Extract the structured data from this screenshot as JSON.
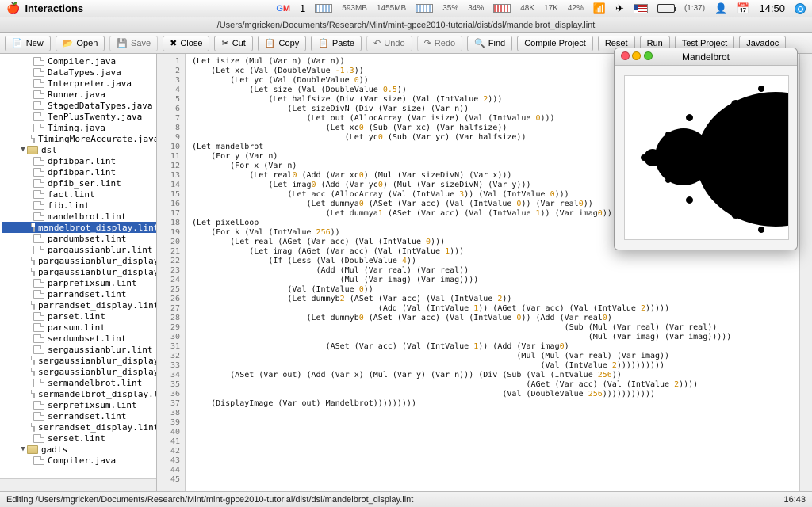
{
  "menubar": {
    "app_name": "Interactions",
    "gmail_count": "1",
    "mem_top": "593MB",
    "mem_bot": "1455MB",
    "pct1": "35%",
    "pct2": "34%",
    "net1": "48K",
    "net2": "17K",
    "pct3": "42%",
    "battery_time": "(1:37)",
    "clock": "14:50"
  },
  "pathbar": {
    "path": "/Users/mgricken/Documents/Research/Mint/mint-gpce2010-tutorial/dist/dsl/mandelbrot_display.lint"
  },
  "toolbar": {
    "new": "New",
    "open": "Open",
    "save": "Save",
    "close": "Close",
    "cut": "Cut",
    "copy": "Copy",
    "paste": "Paste",
    "undo": "Undo",
    "redo": "Redo",
    "find": "Find",
    "compile": "Compile Project",
    "reset": "Reset",
    "run": "Run",
    "test": "Test Project",
    "javadoc": "Javadoc"
  },
  "sidebar": {
    "group1": [
      "Compiler.java",
      "DataTypes.java",
      "Interpreter.java",
      "Runner.java",
      "StagedDataTypes.java",
      "TenPlusTwenty.java",
      "Timing.java",
      "TimingMoreAccurate.java"
    ],
    "folder1": "dsl",
    "dsl": [
      "dpfibpar.lint",
      "dpfibpar.lint",
      "dpfib_ser.lint",
      "fact.lint",
      "fib.lint",
      "mandelbrot.lint",
      "mandelbrot_display.lint",
      "pardumbset.lint",
      "pargaussianblur.lint",
      "pargaussianblur_display.",
      "pargaussianblur_display_.",
      "parprefixsum.lint",
      "parrandset.lint",
      "parrandset_display.lint",
      "parset.lint",
      "parsum.lint",
      "serdumbset.lint",
      "sergaussianblur.lint",
      "sergaussianblur_display.",
      "sergaussianblur_display_.",
      "sermandelbrot.lint",
      "sermandelbrot_display.li",
      "serprefixsum.lint",
      "serrandset.lint",
      "serrandset_display.lint",
      "serset.lint"
    ],
    "folder2": "gadts",
    "gadts": [
      "Compiler.java"
    ]
  },
  "editor": {
    "first_line": 1,
    "last_line": 45,
    "lines": [
      "(Let isize (Mul (Var n) (Var n))",
      "    (Let xc (Val (DoubleValue -1.3))",
      "        (Let yc (Val (DoubleValue 0))",
      "            (Let size (Val (DoubleValue 0.5))",
      "                (Let halfsize (Div (Var size) (Val (IntValue 2)))",
      "                    (Let sizeDivN (Div (Var size) (Var n))",
      "                        (Let out (AllocArray (Var isize) (Val (IntValue 0)))",
      "                            (Let xc0 (Sub (Var xc) (Var halfsize))",
      "                                (Let yc0 (Sub (Var yc) (Var halfsize))",
      "(Let mandelbrot",
      "    (For y (Var n)",
      "        (For x (Var n)",
      "            (Let real0 (Add (Var xc0) (Mul (Var sizeDivN) (Var x)))",
      "                (Let imag0 (Add (Var yc0) (Mul (Var sizeDivN) (Var y)))",
      "                    (Let acc (AllocArray (Val (IntValue 3)) (Val (IntValue 0)))",
      "                        (Let dummya0 (ASet (Var acc) (Val (IntValue 0)) (Var real0))",
      "                            (Let dummya1 (ASet (Var acc) (Val (IntValue 1)) (Var imag0))",
      "(Let pixelLoop",
      "    (For k (Val (IntValue 256))",
      "        (Let real (AGet (Var acc) (Val (IntValue 0)))",
      "            (Let imag (AGet (Var acc) (Val (IntValue 1)))",
      "                (If (Less (Val (DoubleValue 4))",
      "                          (Add (Mul (Var real) (Var real))",
      "                               (Mul (Var imag) (Var imag))))",
      "                    (Val (IntValue 0))",
      "                    (Let dummyb2 (ASet (Var acc) (Val (IntValue 2))",
      "                                       (Add (Val (IntValue 1)) (AGet (Var acc) (Val (IntValue 2)))))",
      "                        (Let dummyb0 (ASet (Var acc) (Val (IntValue 0)) (Add (Var real0)",
      "                                                                              (Sub (Mul (Var real) (Var real))",
      "                                                                                   (Mul (Var imag) (Var imag)))))",
      "                            (ASet (Var acc) (Val (IntValue 1)) (Add (Var imag0)",
      "                                                                    (Mul (Mul (Var real) (Var imag))",
      "                                                                         (Val (IntValue 2))))))))))",
      "        (ASet (Var out) (Add (Var x) (Mul (Var y) (Var n))) (Div (Sub (Val (IntValue 256))",
      "                                                                      (AGet (Var acc) (Val (IntValue 2))))",
      "                                                                 (Val (DoubleValue 256)))))))))))",
      "    (DisplayImage (Var out) Mandelbrot)))))))))",
      "",
      "",
      "",
      "",
      "",
      "",
      "",
      ""
    ]
  },
  "float_window": {
    "title": "Mandelbrot"
  },
  "status_bar": {
    "left": "Editing /Users/mgricken/Documents/Research/Mint/mint-gpce2010-tutorial/dist/dsl/mandelbrot_display.lint",
    "right": "16:43"
  }
}
